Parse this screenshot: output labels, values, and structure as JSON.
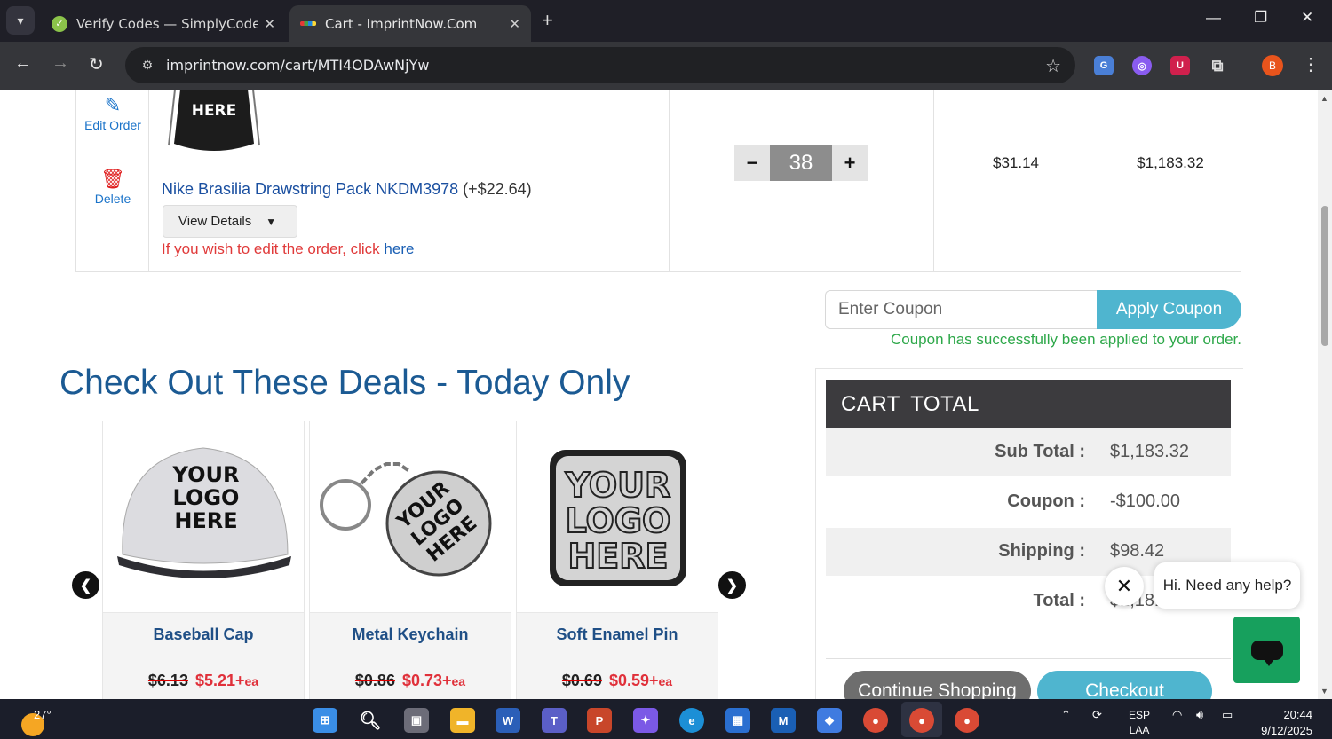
{
  "browser": {
    "tabs": [
      {
        "title": "Verify Codes — SimplyCodes",
        "active": false
      },
      {
        "title": "Cart - ImprintNow.Com",
        "active": true
      }
    ],
    "url": "imprintnow.com/cart/MTI4ODAwNjYw",
    "profile_initial": "B"
  },
  "cart_item": {
    "edit_label": "Edit Order",
    "delete_label": "Delete",
    "bag_text": "HERE",
    "product_name": "Nike Brasilia Drawstring Pack NKDM3978",
    "product_extra": "(+$22.64)",
    "view_details_label": "View Details",
    "edit_note": "If you wish to edit the order, click",
    "edit_note_link": "here",
    "quantity": "38",
    "unit_price": "$31.14",
    "line_total": "$1,183.32"
  },
  "coupon": {
    "placeholder": "Enter Coupon",
    "apply_label": "Apply Coupon",
    "success_message": "Coupon has successfully been applied to your order."
  },
  "deals": {
    "title": "Check Out These Deals - Today Only",
    "items": [
      {
        "name": "Baseball Cap",
        "old_price": "$6.13",
        "new_price": "$5.21+",
        "unit": "ea",
        "logo_lines": [
          "YOUR",
          "LOGO",
          "HERE"
        ]
      },
      {
        "name": "Metal Keychain",
        "old_price": "$0.86",
        "new_price": "$0.73+",
        "unit": "ea",
        "logo_lines": [
          "YOUR",
          "LOGO",
          "HERE"
        ]
      },
      {
        "name": "Soft Enamel Pin",
        "old_price": "$0.69",
        "new_price": "$0.59+",
        "unit": "ea",
        "logo_lines": [
          "YOUR",
          "LOGO",
          "HERE"
        ]
      }
    ]
  },
  "cart_total": {
    "heading": "CART TOTAL",
    "rows": [
      {
        "label": "Sub Total :",
        "value": "$1,183.32"
      },
      {
        "label": "Coupon :",
        "value": "-$100.00"
      },
      {
        "label": "Shipping :",
        "value": "$98.42"
      },
      {
        "label": "Total :",
        "value": "$1,181.7"
      }
    ],
    "continue_label": "Continue Shopping",
    "checkout_label": "Checkout"
  },
  "chat": {
    "greeting": "Hi. Need any help?"
  },
  "taskbar": {
    "temperature": "27°",
    "language": "ESP",
    "layout": "LAA",
    "time": "20:44",
    "date": "9/12/2025"
  },
  "colors": {
    "accent": "#4fb5cf",
    "heading_blue": "#1b5a93",
    "success_green": "#2ea84a",
    "sale_red": "#e0303a",
    "chat_green": "#17a05d"
  }
}
